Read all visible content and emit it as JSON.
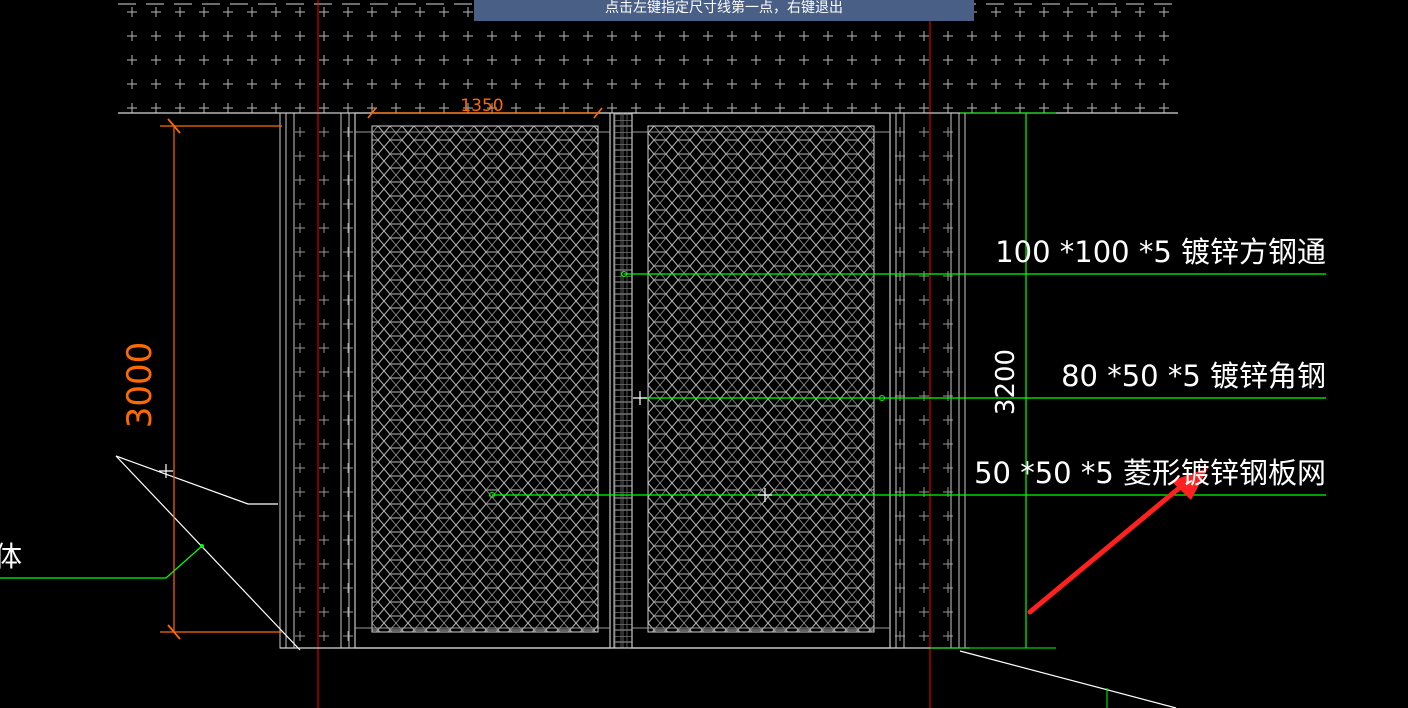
{
  "prompt": {
    "text": "点击左键指定尺寸线第一点，右键退出"
  },
  "dimensions": {
    "width_label": "1350",
    "left_height_label": "3000",
    "right_height_label": "3200"
  },
  "annotations": {
    "square_tube": "100 *100 *5 镀锌方钢通",
    "angle_steel": "80 *50 *5 镀锌角钢",
    "diamond_mesh": "50 *50 *5 菱形镀锌钢板网",
    "left_fragment": "体"
  },
  "colors": {
    "background": "#000000",
    "geometry": "#c8c8c8",
    "leader": "#00ff00",
    "dimension": "#ff6a00",
    "axis": "#ff0000",
    "text": "#ffffff",
    "arrow": "#ff2020",
    "prompt_bg": "#4a5f86"
  }
}
